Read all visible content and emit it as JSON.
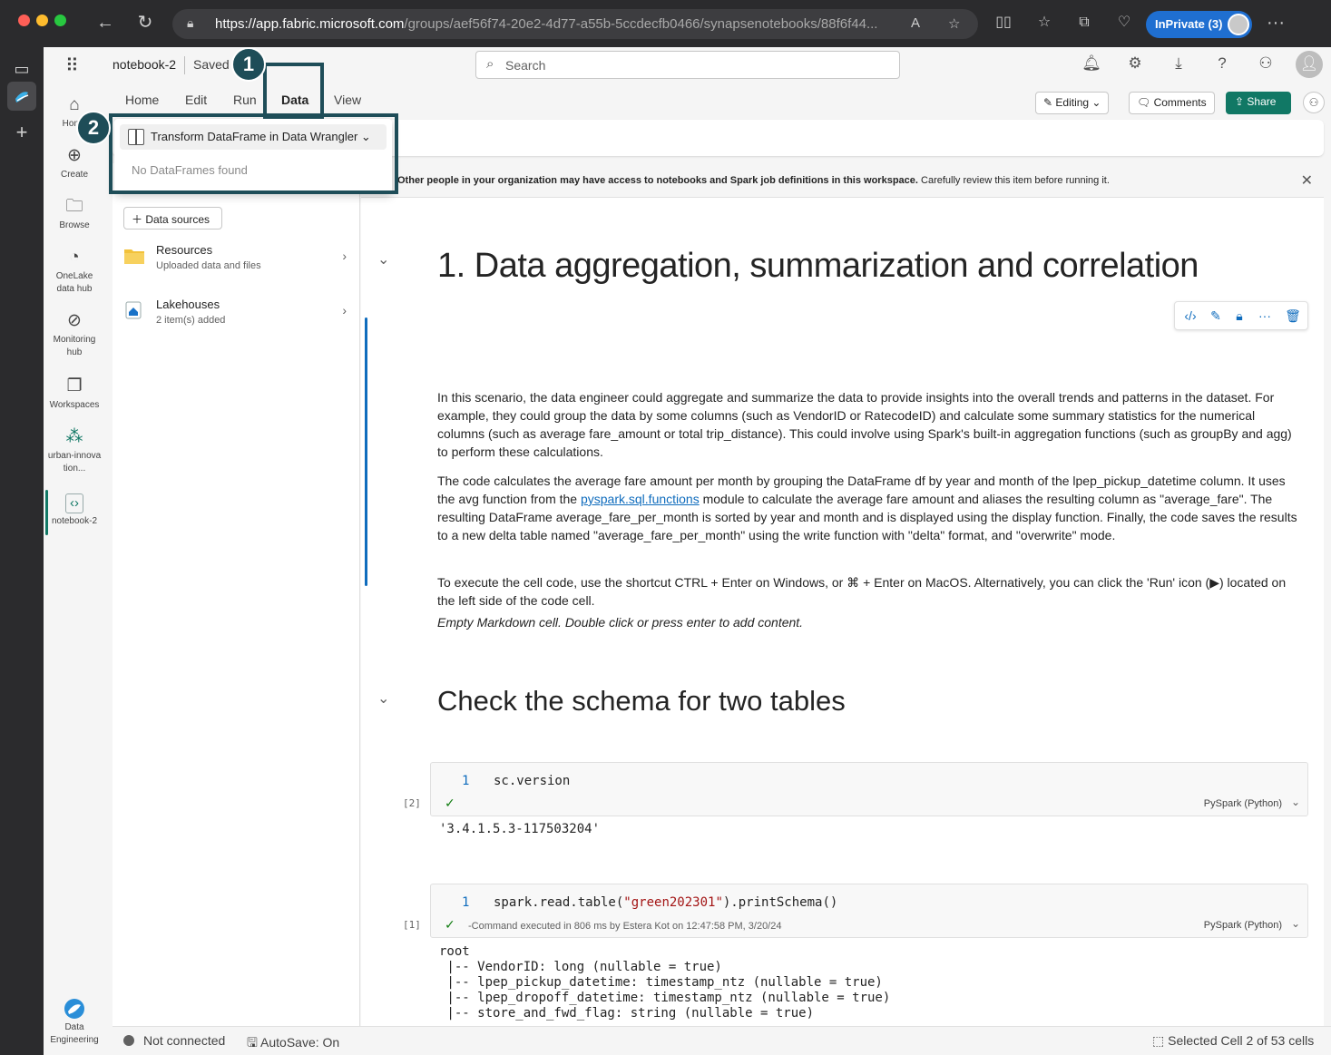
{
  "browser": {
    "url_host": "https://app.fabric.microsoft.com",
    "url_path": "/groups/aef56f74-20e2-4d77-a55b-5ccdecfb0466/synapsenotebooks/88f6f44...",
    "inprivate_label": "InPrivate (3)"
  },
  "topbar": {
    "notebook_name": "notebook-2",
    "save_state": "Saved",
    "search_placeholder": "Search"
  },
  "rail": {
    "items": [
      {
        "label": "Home",
        "icon": "home-icon"
      },
      {
        "label": "Create",
        "icon": "plus-circle-icon"
      },
      {
        "label": "Browse",
        "icon": "folder-icon"
      },
      {
        "label": "OneLake data hub",
        "icon": "onelake-icon"
      },
      {
        "label": "Monitoring hub",
        "icon": "monitor-icon"
      },
      {
        "label": "Workspaces",
        "icon": "workspaces-icon"
      },
      {
        "label": "urban-innovation...",
        "icon": "people-icon"
      },
      {
        "label": "notebook-2",
        "icon": "notebook-icon"
      }
    ],
    "bottom_label": "Data Engineering"
  },
  "ribbon": {
    "tabs": [
      "Home",
      "Edit",
      "Run",
      "Data",
      "View"
    ],
    "active_tab": "Data",
    "editing_label": "Editing",
    "comments_label": "Comments",
    "share_label": "Share"
  },
  "data_menu": {
    "transform_label": "Transform DataFrame in Data Wrangler",
    "empty_text": "No DataFrames found"
  },
  "explorer": {
    "add_source_label": "Data sources",
    "items": [
      {
        "title": "Resources",
        "subtitle": "Uploaded data and files"
      },
      {
        "title": "Lakehouses",
        "subtitle": "2 item(s) added"
      }
    ]
  },
  "banner": {
    "bold_text": "Other people in your organization may have access to notebooks and Spark job definitions in this workspace.",
    "normal_text": " Carefully review this item before running it."
  },
  "notebook": {
    "heading1": "1. Data aggregation, summarization and correlation",
    "para1": "In this scenario, the data engineer could aggregate and summarize the data to provide insights into the overall trends and patterns in the dataset. For example, they could group the data by some columns (such as VendorID or RatecodeID) and calculate some summary statistics for the numerical columns (such as average fare_amount or total trip_distance). This could involve using Spark's built-in aggregation functions (such as groupBy and agg) to perform these calculations.",
    "para2_before_link": "The code calculates the average fare amount per month by grouping the DataFrame df by year and month of the lpep_pickup_datetime column. It uses the avg function from the ",
    "para2_link": "pyspark.sql.functions",
    "para2_after_link": " module to calculate the average fare amount and aliases the resulting column as \"average_fare\". The resulting DataFrame average_fare_per_month is sorted by year and month and is displayed using the display function. Finally, the code saves the results to a new delta table named \"average_fare_per_month\" using the write function with \"delta\" format, and \"overwrite\" mode.",
    "para3": "To execute the cell code, use the shortcut CTRL + Enter on Windows, or ⌘ + Enter on MacOS. Alternatively, you can click the 'Run' icon (▶) located on the left side of the code cell.",
    "empty_markdown": "Empty Markdown cell. Double click or press enter to add content.",
    "heading2": "Check the schema for two tables",
    "cell1": {
      "line": "1",
      "code": "sc.version",
      "exec_count": "[2]",
      "language": "PySpark (Python)",
      "output": "'3.4.1.5.3-117503204'"
    },
    "cell2": {
      "line": "1",
      "code_before": "spark.read.table(",
      "code_string": "\"green202301\"",
      "code_after": ").printSchema()",
      "exec_count": "[1]",
      "exec_msg": "-Command executed in 806 ms by Estera Kot on 12:47:58 PM, 3/20/24",
      "language": "PySpark (Python)",
      "output": "root\n |-- VendorID: long (nullable = true)\n |-- lpep_pickup_datetime: timestamp_ntz (nullable = true)\n |-- lpep_dropoff_datetime: timestamp_ntz (nullable = true)\n |-- store_and_fwd_flag: string (nullable = true)"
    }
  },
  "statusbar": {
    "connection": "Not connected",
    "autosave": "AutoSave: On",
    "selection": "Selected Cell 2 of 53 cells"
  },
  "callouts": {
    "step1": "1",
    "step2": "2"
  }
}
